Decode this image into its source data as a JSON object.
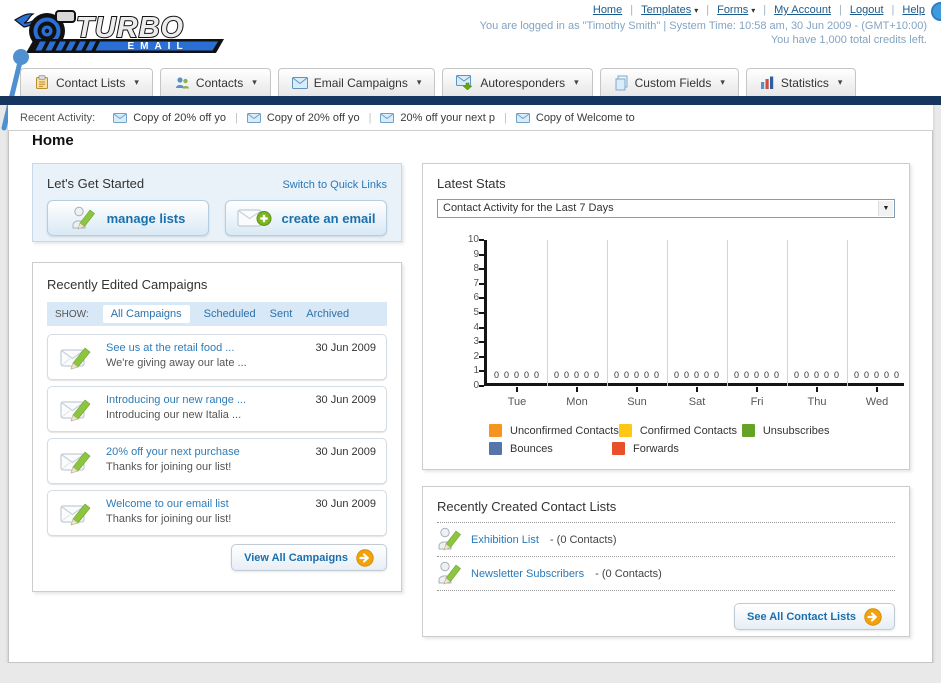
{
  "colors": {
    "navy": "#17365f",
    "link_blue": "#1b6fad",
    "accent_orange": "#f2a30b"
  },
  "header": {
    "logo_title": "TURBO",
    "logo_subtitle": "EMAIL",
    "nav_links": [
      {
        "label": "Home",
        "dropdown": false
      },
      {
        "label": "Templates",
        "dropdown": true
      },
      {
        "label": "Forms",
        "dropdown": true
      },
      {
        "label": "My Account",
        "dropdown": false
      },
      {
        "label": "Logout",
        "dropdown": false
      },
      {
        "label": "Help",
        "dropdown": false
      }
    ],
    "login_text": "You are logged in as \"Timothy Smith\" | System Time: 10:58 am, 30 Jun 2009 - (GMT+10:00)",
    "credits_text": "You have 1,000 total credits left."
  },
  "nav_tabs": [
    {
      "label": "Contact Lists",
      "icon": "contact-list-icon"
    },
    {
      "label": "Contacts",
      "icon": "contacts-icon"
    },
    {
      "label": "Email Campaigns",
      "icon": "envelope-icon"
    },
    {
      "label": "Autoresponders",
      "icon": "autoresponder-icon"
    },
    {
      "label": "Custom Fields",
      "icon": "custom-fields-icon"
    },
    {
      "label": "Statistics",
      "icon": "statistics-icon"
    }
  ],
  "recent_activity": {
    "label": "Recent Activity:",
    "items": [
      "Copy of 20% off yo",
      "Copy of 20% off yo",
      "20% off your next p",
      "Copy of Welcome to"
    ]
  },
  "main": {
    "heading": "Home"
  },
  "get_started": {
    "title": "Let's Get Started",
    "switch_link": "Switch to Quick Links",
    "buttons": [
      {
        "label": "manage lists",
        "icon": "person-pencil-icon"
      },
      {
        "label": "create an email",
        "icon": "create-email-icon"
      }
    ]
  },
  "campaigns": {
    "title": "Recently Edited Campaigns",
    "show_label": "SHOW:",
    "filters": [
      {
        "label": "All Campaigns",
        "active": true
      },
      {
        "label": "Scheduled",
        "active": false
      },
      {
        "label": "Sent",
        "active": false
      },
      {
        "label": "Archived",
        "active": false
      }
    ],
    "items": [
      {
        "title": "See us at the retail food ...",
        "subtitle": "We're giving away our late ...",
        "date": "30 Jun 2009"
      },
      {
        "title": "Introducing our new range ...",
        "subtitle": "Introducing our new Italia ...",
        "date": "30 Jun 2009"
      },
      {
        "title": "20% off your next purchase",
        "subtitle": "Thanks for joining our list!",
        "date": "30 Jun 2009"
      },
      {
        "title": "Welcome to our email list",
        "subtitle": "Thanks for joining our list!",
        "date": "30 Jun 2009"
      }
    ],
    "view_all_label": "View All Campaigns"
  },
  "latest_stats": {
    "title": "Latest Stats",
    "dropdown_value": "Contact Activity for the Last 7 Days"
  },
  "chart_data": {
    "type": "bar",
    "title": "Contact Activity for the Last 7 Days",
    "categories": [
      "Tue",
      "Mon",
      "Sun",
      "Sat",
      "Fri",
      "Thu",
      "Wed"
    ],
    "series": [
      {
        "name": "Unconfirmed Contacts",
        "color": "#f7941e",
        "values": [
          0,
          0,
          0,
          0,
          0,
          0,
          0
        ]
      },
      {
        "name": "Confirmed Contacts",
        "color": "#fdc713",
        "values": [
          0,
          0,
          0,
          0,
          0,
          0,
          0
        ]
      },
      {
        "name": "Unsubscribes",
        "color": "#66a226",
        "values": [
          0,
          0,
          0,
          0,
          0,
          0,
          0
        ]
      },
      {
        "name": "Bounces",
        "color": "#5674a7",
        "values": [
          0,
          0,
          0,
          0,
          0,
          0,
          0
        ]
      },
      {
        "name": "Forwards",
        "color": "#e8502a",
        "values": [
          0,
          0,
          0,
          0,
          0,
          0,
          0
        ]
      }
    ],
    "xlabel": "",
    "ylabel": "",
    "ylim": [
      0,
      10
    ],
    "ytick_step": 1,
    "grid": true,
    "legend_position": "bottom"
  },
  "contact_lists": {
    "title": "Recently Created Contact Lists",
    "items": [
      {
        "name": "Exhibition List",
        "detail": "- (0 Contacts)"
      },
      {
        "name": "Newsletter Subscribers",
        "detail": "- (0 Contacts)"
      }
    ],
    "see_all_label": "See All Contact Lists"
  }
}
